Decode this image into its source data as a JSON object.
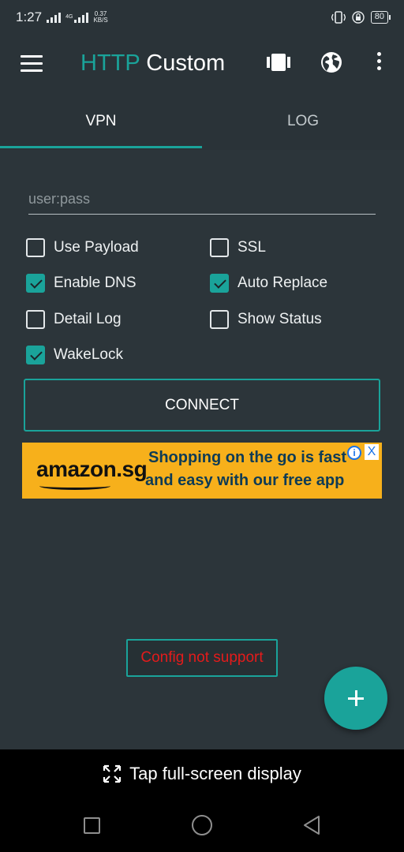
{
  "status_bar": {
    "time": "1:27",
    "network_type": "4G",
    "speed_value": "0.37",
    "speed_unit": "KB/S",
    "battery": "80"
  },
  "app_bar": {
    "title_accent": "HTTP",
    "title_rest": " Custom"
  },
  "tabs": [
    {
      "label": "VPN",
      "selected": true
    },
    {
      "label": "LOG",
      "selected": false
    }
  ],
  "form": {
    "userpass_placeholder": "user:pass",
    "userpass_value": ""
  },
  "options": {
    "use_payload": {
      "label": "Use Payload",
      "checked": false
    },
    "ssl": {
      "label": "SSL",
      "checked": false
    },
    "enable_dns": {
      "label": "Enable DNS",
      "checked": true
    },
    "auto_replace": {
      "label": "Auto Replace",
      "checked": true
    },
    "detail_log": {
      "label": "Detail Log",
      "checked": false
    },
    "show_status": {
      "label": "Show Status",
      "checked": false
    },
    "wakelock": {
      "label": "WakeLock",
      "checked": true
    }
  },
  "connect_label": "CONNECT",
  "ad": {
    "brand": "amazon.sg",
    "line1": "Shopping on the go is fast",
    "line2": "and easy with our free app",
    "info_label": "i",
    "close_label": "X"
  },
  "config_status": "Config not support",
  "fab_icon": "plus-icon",
  "fullscreen_hint": "Tap full-screen display",
  "colors": {
    "accent": "#1aa39a",
    "background": "#2c353a",
    "error": "#e41b1b",
    "ad_bg": "#f7b01b"
  }
}
